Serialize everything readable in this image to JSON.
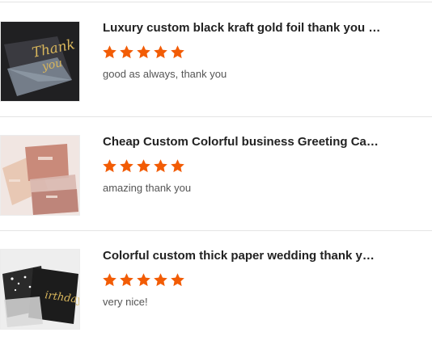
{
  "reviews": [
    {
      "title": "Luxury custom black kraft gold foil thank you g...",
      "rating": 5,
      "comment": "good as always, thank you",
      "thumb_icon": "product-photo-black-gold-thank-you-card"
    },
    {
      "title": "Cheap Custom Colorful business Greeting Card...",
      "rating": 5,
      "comment": "amazing thank you",
      "thumb_icon": "product-photo-pink-greeting-cards"
    },
    {
      "title": "Colorful custom thick paper wedding thank you...",
      "rating": 5,
      "comment": "very nice!",
      "thumb_icon": "product-photo-black-gold-birthday-cards"
    }
  ],
  "colors": {
    "star": "#f25c05",
    "title": "#222222",
    "comment": "#555555",
    "divider": "#e4e4e4"
  }
}
